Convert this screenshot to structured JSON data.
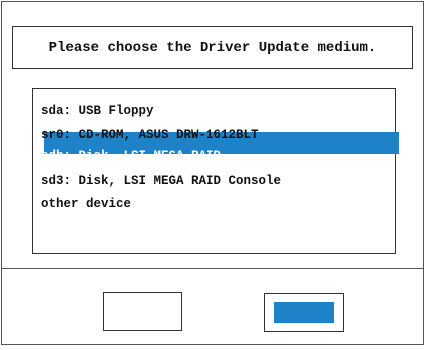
{
  "dialog": {
    "title": "Please choose the Driver Update medium."
  },
  "device_list": {
    "items": [
      {
        "label": "sda: USB Floppy"
      },
      {
        "label": "sr0: CD-ROM, ASUS DRW-1612BLT"
      },
      {
        "label": "sdb: Disk, LSI MEGA RAID",
        "selected": true
      },
      {
        "label": "sd3: Disk, LSI MEGA RAID Console"
      },
      {
        "label": "other device"
      }
    ],
    "highlight_color": "#1e82c8"
  },
  "buttons": {
    "left_label": "",
    "right_label": "",
    "focused": "right"
  }
}
